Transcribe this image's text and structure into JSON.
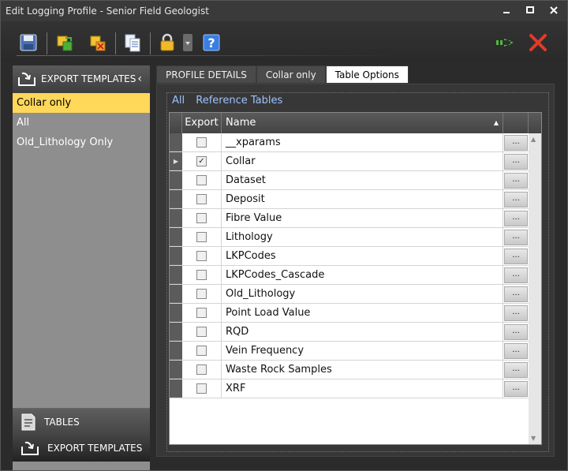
{
  "window": {
    "title": "Edit Logging Profile - Senior Field Geologist"
  },
  "toolbar": {
    "icons": [
      "save-icon",
      "import-icon",
      "delete-icon",
      "copy-icon",
      "lock-icon",
      "dropdown-icon",
      "help-icon",
      "go-arrow-icon",
      "close-x-icon"
    ],
    "help_label": "?"
  },
  "sidebar": {
    "header": "EXPORT TEMPLATES",
    "items": [
      {
        "label": "Collar only",
        "selected": true
      },
      {
        "label": "All",
        "selected": false
      },
      {
        "label": "Old_Lithology Only",
        "selected": false
      }
    ],
    "bottom_tables": "TABLES",
    "bottom_export": "EXPORT TEMPLATES"
  },
  "tabs": [
    {
      "label": "PROFILE DETAILS",
      "active": false
    },
    {
      "label": "Collar only",
      "active": false
    },
    {
      "label": "Table Options",
      "active": true
    }
  ],
  "filters": {
    "all": "All",
    "reference": "Reference Tables"
  },
  "grid": {
    "columns": {
      "export": "Export",
      "name": "Name"
    },
    "ellipsis": "...",
    "rows": [
      {
        "name": "__xparams",
        "checked": false,
        "current": false
      },
      {
        "name": "Collar",
        "checked": true,
        "current": true
      },
      {
        "name": "Dataset",
        "checked": false,
        "current": false
      },
      {
        "name": "Deposit",
        "checked": false,
        "current": false
      },
      {
        "name": "Fibre Value",
        "checked": false,
        "current": false
      },
      {
        "name": "Lithology",
        "checked": false,
        "current": false
      },
      {
        "name": "LKPCodes",
        "checked": false,
        "current": false
      },
      {
        "name": "LKPCodes_Cascade",
        "checked": false,
        "current": false
      },
      {
        "name": "Old_Lithology",
        "checked": false,
        "current": false
      },
      {
        "name": "Point Load Value",
        "checked": false,
        "current": false
      },
      {
        "name": "RQD",
        "checked": false,
        "current": false
      },
      {
        "name": "Vein Frequency",
        "checked": false,
        "current": false
      },
      {
        "name": "Waste Rock Samples",
        "checked": false,
        "current": false
      },
      {
        "name": "XRF",
        "checked": false,
        "current": false
      }
    ]
  },
  "colors": {
    "selection": "#ffd85a",
    "link": "#9cc3ff",
    "close_red": "#e03b2b",
    "arrow_green": "#4dbb3c"
  }
}
